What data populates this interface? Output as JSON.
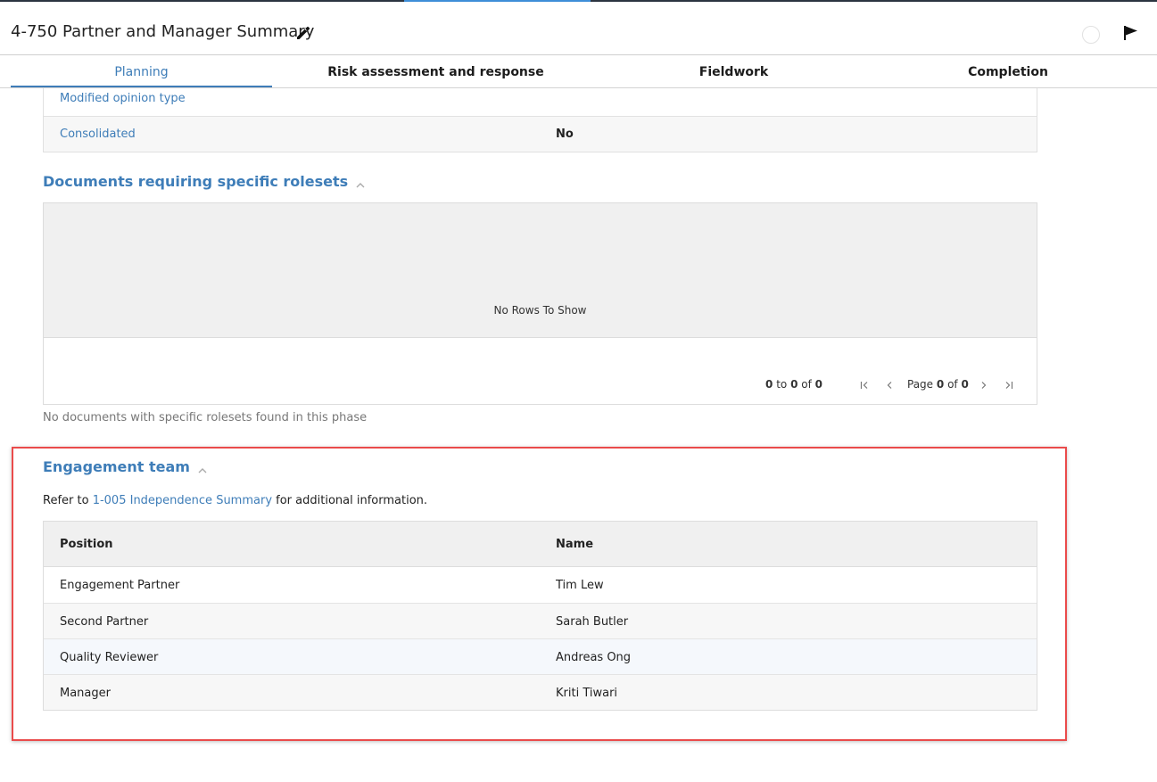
{
  "header": {
    "title": "4-750 Partner and Manager Summary",
    "edit_icon": "pencil-icon",
    "status_icon": "circle-icon",
    "flag_icon": "flag-icon"
  },
  "tabs": [
    {
      "label": "Planning",
      "active": true
    },
    {
      "label": "Risk assessment and response",
      "active": false
    },
    {
      "label": "Fieldwork",
      "active": false
    },
    {
      "label": "Completion",
      "active": false
    }
  ],
  "details": [
    {
      "label": "Modified opinion type",
      "value": ""
    },
    {
      "label": "Consolidated",
      "value": "No"
    }
  ],
  "documents_section": {
    "title": "Documents requiring specific rolesets",
    "empty_text": "No Rows To Show",
    "pager": {
      "from": "0",
      "to_word": "to",
      "to": "0",
      "of_word": "of",
      "total": "0",
      "page_word": "Page",
      "page": "0",
      "page_of_word": "of",
      "pages": "0"
    },
    "note": "No documents with specific rolesets found in this phase"
  },
  "engagement_team": {
    "title": "Engagement team",
    "refer_prefix": "Refer to",
    "refer_link": "1-005 Independence Summary",
    "refer_suffix": "for additional information.",
    "columns": [
      "Position",
      "Name"
    ],
    "rows": [
      {
        "position": "Engagement Partner",
        "name": "Tim Lew"
      },
      {
        "position": "Second Partner",
        "name": "Sarah Butler"
      },
      {
        "position": "Quality Reviewer",
        "name": "Andreas Ong"
      },
      {
        "position": "Manager",
        "name": "Kriti Tiwari"
      }
    ]
  },
  "colors": {
    "accent": "#3e7db8",
    "highlight": "#ea4b4b",
    "table_header_bg": "#f0f0f0"
  }
}
